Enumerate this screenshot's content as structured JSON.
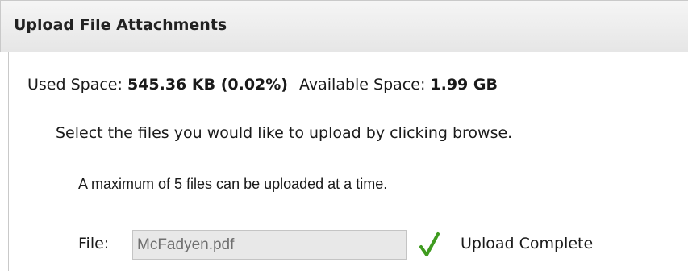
{
  "window": {
    "title": "Upload File Attachments"
  },
  "space": {
    "used_label": "Used Space:",
    "used_value": "545.36 KB (0.02%)",
    "available_label": "Available Space:",
    "available_value": "1.99 GB"
  },
  "instructions": {
    "select_text": "Select the files you would like to upload by clicking browse.",
    "max_text": "A maximum of 5 files can be uploaded at a time."
  },
  "file": {
    "label": "File:",
    "value": "McFadyen.pdf",
    "status_icon": "checkmark-icon",
    "status_color": "#3f9b1f",
    "status_text": "Upload Complete"
  }
}
